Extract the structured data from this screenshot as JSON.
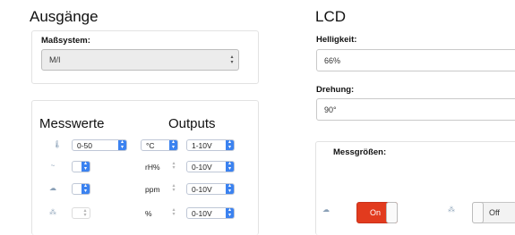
{
  "left": {
    "title": "Ausgänge",
    "unit_system": {
      "label": "Maßsystem:",
      "value": "M/I"
    },
    "measurements": {
      "heading": "Messwerte",
      "outputs_heading": "Outputs",
      "rows": [
        {
          "icon": "thermometer-icon",
          "range": "0-50",
          "unit": "°C",
          "output": "1-10V"
        },
        {
          "icon": "humidity-icon",
          "range": "",
          "unit": "rH%",
          "output": "0-10V"
        },
        {
          "icon": "co2-icon",
          "range": "",
          "unit": "ppm",
          "output": "0-10V"
        },
        {
          "icon": "voc-icon",
          "range": "",
          "unit": "%",
          "output": "0-10V"
        }
      ]
    }
  },
  "right": {
    "title": "LCD",
    "brightness": {
      "label": "Helligkeit:",
      "value": "66%"
    },
    "rotation": {
      "label": "Drehung:",
      "value": "90°"
    },
    "metrics": {
      "label": "Messgrößen:",
      "toggles": [
        {
          "icon": "co2-icon",
          "state": "On"
        },
        {
          "icon": "voc-icon",
          "state": "Off"
        }
      ]
    }
  }
}
